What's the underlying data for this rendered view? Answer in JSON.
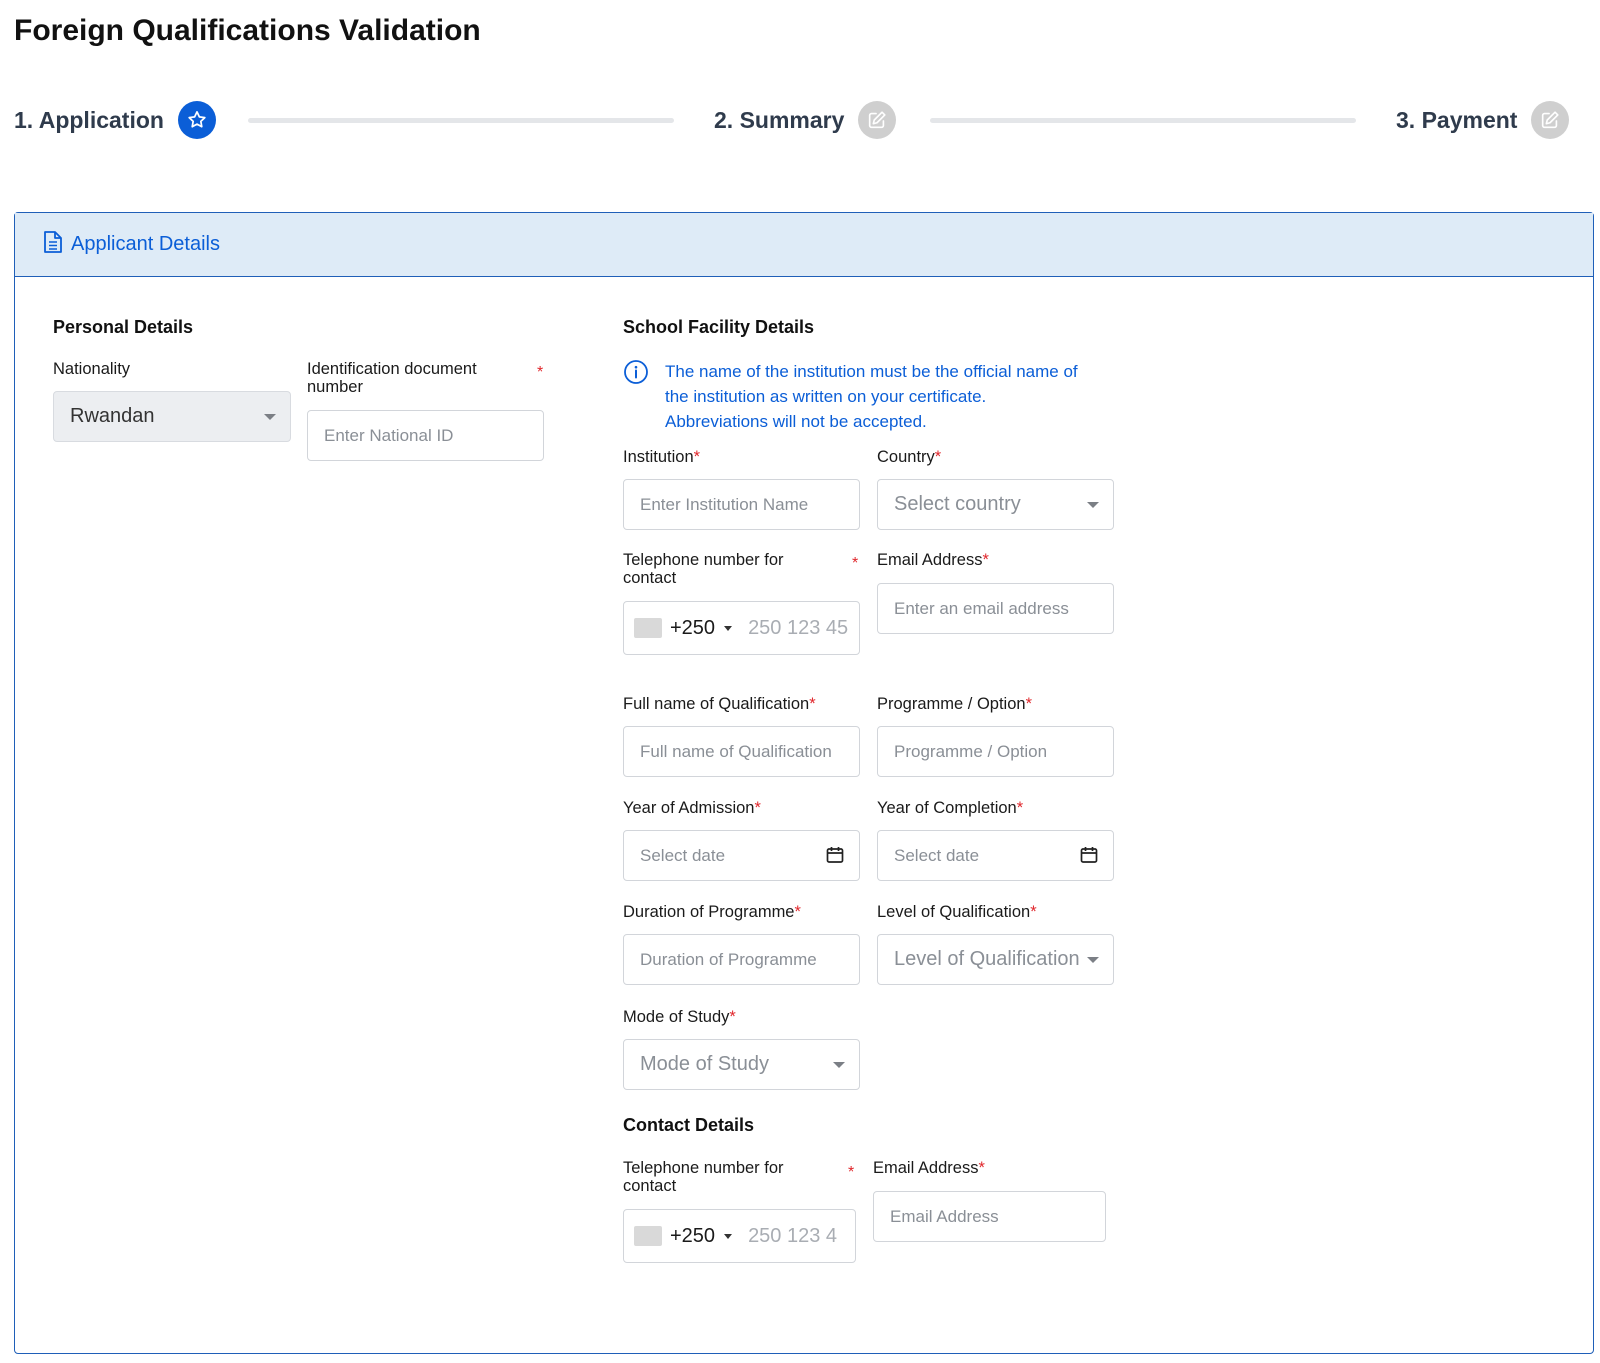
{
  "page": {
    "title": "Foreign Qualifications Validation"
  },
  "stepper": {
    "steps": [
      {
        "label": "1. Application",
        "icon": "star-icon",
        "state": "active"
      },
      {
        "label": "2. Summary",
        "icon": "edit-icon",
        "state": "inactive"
      },
      {
        "label": "3. Payment",
        "icon": "edit-icon",
        "state": "inactive"
      }
    ]
  },
  "card": {
    "title": "Applicant Details",
    "icon": "document-icon"
  },
  "personal": {
    "title": "Personal Details",
    "nationality_label": "Nationality",
    "nationality_value": "Rwandan",
    "id_label": "Identification document number",
    "id_placeholder": "Enter National ID"
  },
  "school": {
    "title": "School Facility Details",
    "info": "The name of the institution must be the official name of the institution as written on your certificate. Abbreviations will not be accepted.",
    "info_lines": [
      "The name of the institution must be the official name of",
      "the institution as written on your certificate.",
      "Abbreviations will not be accepted."
    ],
    "institution_label": "Institution",
    "institution_placeholder": "Enter Institution Name",
    "country_label": "Country",
    "country_placeholder": "Select country",
    "phone_label": "Telephone number for contact",
    "phone_code": "+250",
    "phone_placeholder": "250 123 45",
    "email_label": "Email Address",
    "email_placeholder": "Enter an email address",
    "qual_name_label": "Full name of Qualification",
    "qual_name_placeholder": "Full name of Qualification",
    "programme_label": "Programme / Option",
    "programme_placeholder": "Programme / Option",
    "admission_label": "Year of Admission",
    "admission_placeholder": "Select date",
    "completion_label": "Year of Completion",
    "completion_placeholder": "Select date",
    "duration_label": "Duration of Programme",
    "duration_placeholder": "Duration of Programme",
    "level_label": "Level of Qualification",
    "level_placeholder": "Level of Qualification",
    "mode_label": "Mode of Study",
    "mode_placeholder": "Mode of Study"
  },
  "contact": {
    "title": "Contact Details",
    "phone_label": "Telephone number for contact",
    "phone_code": "+250",
    "phone_placeholder": "250 123 4",
    "email_label": "Email Address",
    "email_placeholder": "Email Address"
  },
  "colors": {
    "accent": "#0b5ed7",
    "required": "#e0262b",
    "header_bg": "#deebf7"
  }
}
